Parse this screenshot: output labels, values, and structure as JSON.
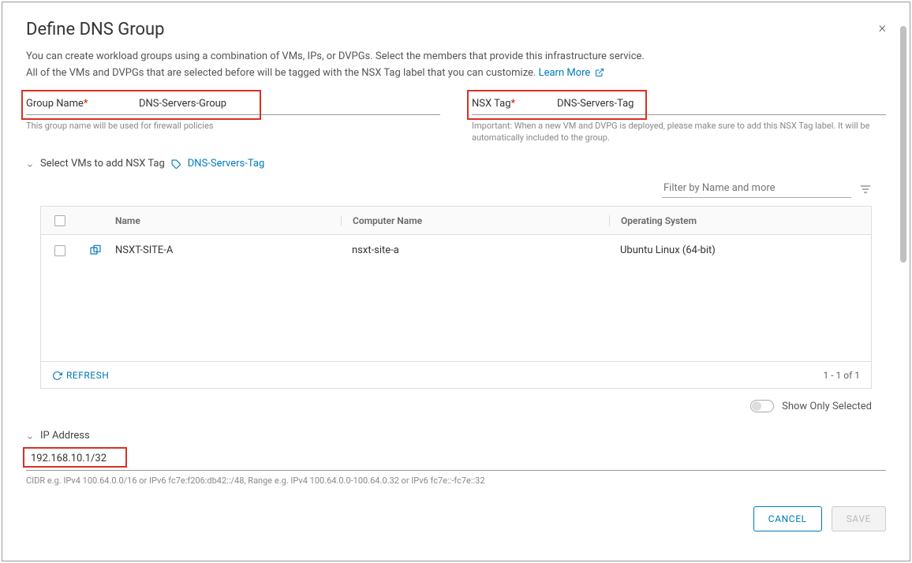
{
  "title": "Define DNS Group",
  "desc_line1": "You can create workload groups using a combination of VMs, IPs, or DVPGs. Select the members that provide this infrastructure service.",
  "desc_line2_a": "All of the VMs and DVPGs that are selected before will be tagged with the NSX Tag label that you can customize. ",
  "learn_more": "Learn More",
  "group_name": {
    "label": "Group Name",
    "value": "DNS-Servers-Group",
    "hint": "This group name will be used for firewall policies"
  },
  "nsx_tag": {
    "label": "NSX Tag",
    "value": "DNS-Servers-Tag",
    "hint": "Important: When a new VM and DVPG is deployed, please make sure to add this NSX Tag label. It will be automatically included to the group."
  },
  "vm_section": {
    "header": "Select VMs to add NSX Tag",
    "tag": "DNS-Servers-Tag",
    "filter_placeholder": "Filter by Name and more"
  },
  "table": {
    "headers": {
      "name": "Name",
      "comp": "Computer Name",
      "os": "Operating System"
    },
    "rows": [
      {
        "name": "NSXT-SITE-A",
        "comp": "nsxt-site-a",
        "os": "Ubuntu Linux (64-bit)"
      }
    ],
    "refresh": "REFRESH",
    "page": "1 - 1 of 1"
  },
  "show_only": "Show Only Selected",
  "ip_section": {
    "header": "IP Address",
    "value": "192.168.10.1/32",
    "hint": "CIDR e.g. IPv4 100.64.0.0/16 or IPv6 fc7e:f206:db42::/48, Range e.g. IPv4 100.64.0.0-100.64.0.32 or IPv6 fc7e::-fc7e::32"
  },
  "buttons": {
    "cancel": "CANCEL",
    "save": "SAVE"
  }
}
